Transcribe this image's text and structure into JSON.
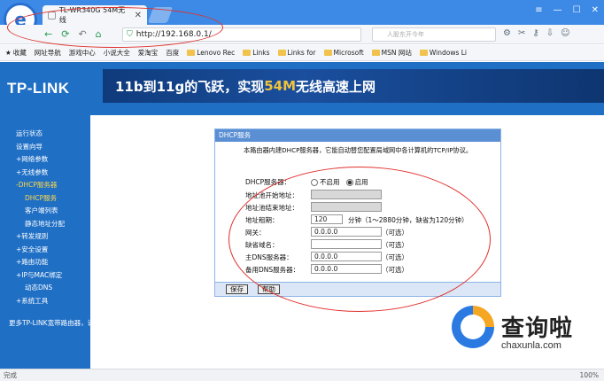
{
  "browser": {
    "tab_title": "TL-WR340G 54M无线",
    "url": "http://192.168.0.1/",
    "search_placeholder": "人股东开今年",
    "bookmarks": [
      "收藏",
      "网址导航",
      "游戏中心",
      "小说大全",
      "爱淘宝",
      "百度",
      "Lenovo Rec",
      "Links",
      "Links for",
      "Microsoft",
      "MSN 网站",
      "Windows Li"
    ],
    "status_text": "完成",
    "zoom": "100%"
  },
  "banner": {
    "brand": "TP-LINK",
    "slogan_a": "11b到11g的飞跃，实现",
    "slogan_hl": "54M",
    "slogan_b": "无线高速上网"
  },
  "sidebar": {
    "items": [
      "运行状态",
      "设置向导",
      "+网络参数",
      "+无线参数",
      "-DHCP服务器",
      "DHCP服务",
      "客户端列表",
      "静态地址分配",
      "+转发规则",
      "+安全设置",
      "+路由功能",
      "+IP与MAC绑定",
      "动态DNS",
      "+系统工具"
    ],
    "more": "更多TP-LINK宽带路由器，请点击查看 >>"
  },
  "dhcp": {
    "title": "DHCP服务",
    "description": "本路由器内建DHCP服务器，它能自动替您配置局域网中各计算机的TCP/IP协议。",
    "server_label": "DHCP服务器：",
    "opt_off": "不启用",
    "opt_on": "启用",
    "start_label": "地址池开始地址：",
    "end_label": "地址池结束地址：",
    "lease_label": "地址租期：",
    "lease_value": "120",
    "lease_hint": "分钟（1～2880分钟，缺省为120分钟）",
    "gateway_label": "网关：",
    "gateway_value": "0.0.0.0",
    "domain_label": "缺省域名：",
    "dns1_label": "主DNS服务器：",
    "dns1_value": "0.0.0.0",
    "dns2_label": "备用DNS服务器：",
    "dns2_value": "0.0.0.0",
    "optional": "（可选）",
    "save": "保存",
    "help": "帮助"
  },
  "watermark": {
    "text": "查询啦",
    "url": "chaxunla.com"
  }
}
